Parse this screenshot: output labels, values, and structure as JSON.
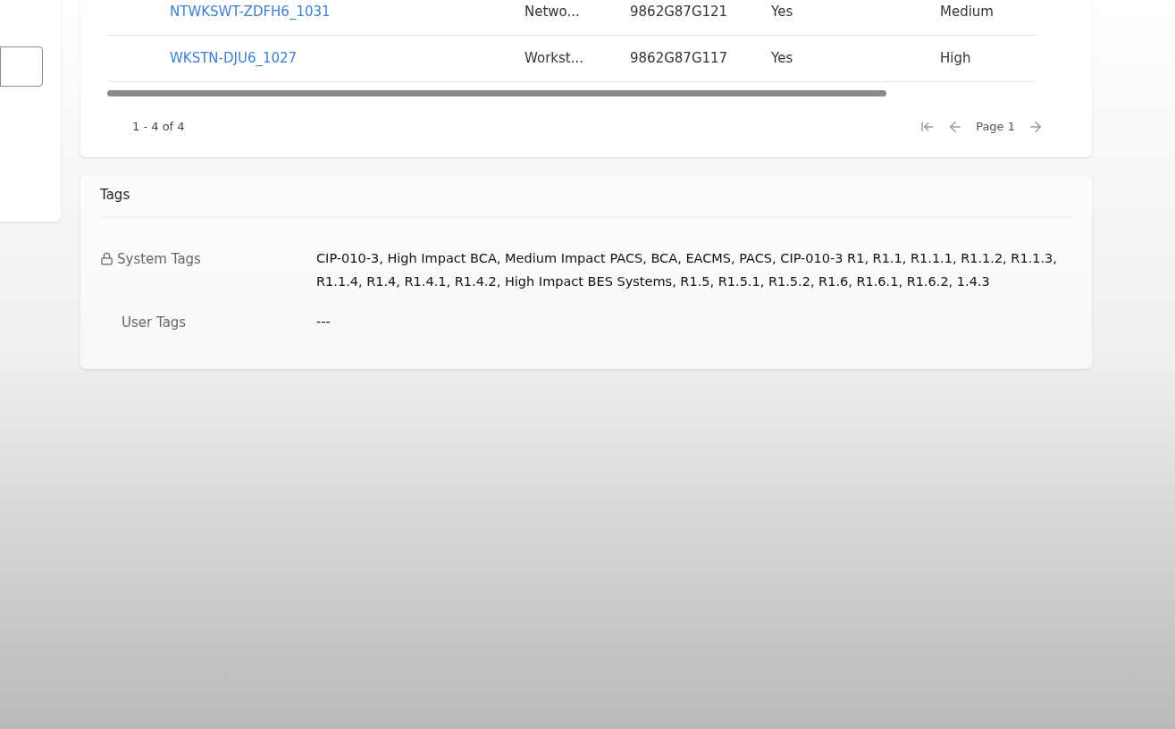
{
  "table": {
    "rows": [
      {
        "name": "NTWKSWT-ZDFH6_1031",
        "column_2": "Netwo...",
        "column_3": "9862G87G121",
        "column_4": "Yes",
        "column_5": "Medium"
      },
      {
        "name": "WKSTN-DJU6_1027",
        "column_2": "Workst...",
        "column_3": "9862G87G117",
        "column_4": "Yes",
        "column_5": "High"
      }
    ]
  },
  "pagination": {
    "range": "1 - 4 of 4",
    "page": "Page 1"
  },
  "tags": {
    "title": "Tags",
    "rows": [
      {
        "label": "System Tags",
        "locked": true,
        "value": "CIP-010-3, High Impact BCA, Medium Impact PACS, BCA, EACMS, PACS, CIP-010-3 R1, R1.1, R1.1.1, R1.1.2, R1.1.3, R1.1.4, R1.4, R1.4.1, R1.4.2, High Impact BES Systems, R1.5, R1.5.1, R1.5.2, R1.6, R1.6.1, R1.6.2, 1.4.3"
      },
      {
        "label": "User Tags",
        "locked": false,
        "value": "---"
      }
    ]
  }
}
